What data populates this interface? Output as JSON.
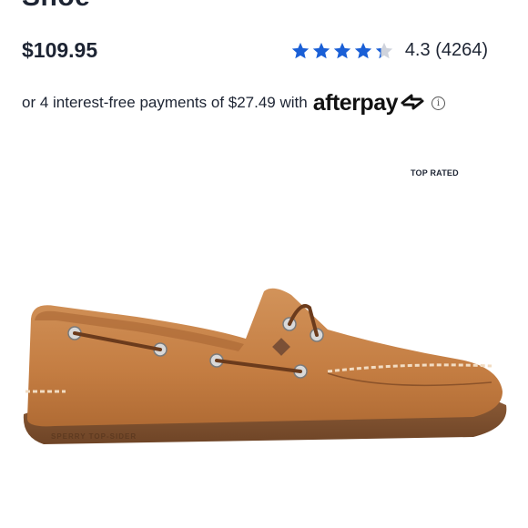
{
  "product": {
    "title_fragment": "Shoe",
    "price": "$109.95",
    "rating": {
      "stars": 4.3,
      "value": "4.3",
      "count": "(4264)",
      "star_color": "#1a5fd6"
    },
    "installments": {
      "text": "or 4 interest-free payments of $27.49 with",
      "provider": "afterpay",
      "info_icon": "info-icon"
    },
    "badge": "TOP RATED",
    "image": {
      "description_icon": "shoe-image",
      "imprint": "SPERRY TOP-SIDER"
    }
  }
}
